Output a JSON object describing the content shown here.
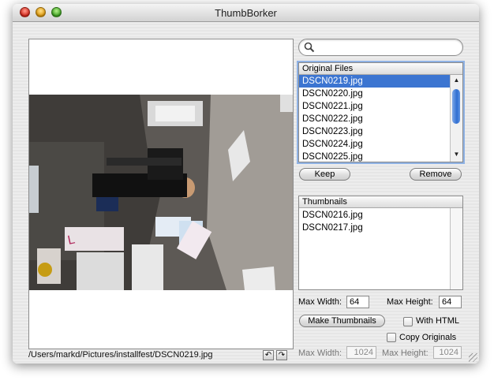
{
  "window": {
    "title": "ThumbBorker"
  },
  "preview": {
    "path": "/Users/markd/Pictures/installfest/DSCN0219.jpg"
  },
  "search": {
    "value": "",
    "placeholder": ""
  },
  "original_files": {
    "header": "Original Files",
    "items": [
      "DSCN0219.jpg",
      "DSCN0220.jpg",
      "DSCN0221.jpg",
      "DSCN0222.jpg",
      "DSCN0223.jpg",
      "DSCN0224.jpg",
      "DSCN0225.jpg"
    ],
    "selected_index": 0
  },
  "buttons": {
    "keep": "Keep",
    "remove": "Remove",
    "make_thumbnails": "Make Thumbnails"
  },
  "thumbnails": {
    "header": "Thumbnails",
    "items": [
      "DSCN0216.jpg",
      "DSCN0217.jpg"
    ]
  },
  "thumb_settings": {
    "max_width_label": "Max Width:",
    "max_width_value": "64",
    "max_height_label": "Max Height:",
    "max_height_value": "64"
  },
  "options": {
    "with_html": "With HTML",
    "copy_originals": "Copy Originals",
    "with_html_checked": false,
    "copy_originals_checked": false
  },
  "original_settings": {
    "max_width_label": "Max Width:",
    "max_width_value": "1024",
    "max_height_label": "Max Height:",
    "max_height_value": "1024"
  },
  "colors": {
    "selection": "#3c75d1",
    "focus_ring": "#8fb2e4"
  }
}
